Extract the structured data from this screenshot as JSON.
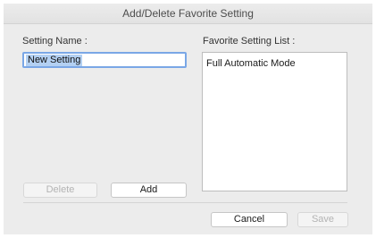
{
  "window": {
    "title": "Add/Delete Favorite Setting"
  },
  "setting_name": {
    "label": "Setting Name :",
    "value": "New Setting"
  },
  "favorite_list": {
    "label": "Favorite Setting List :",
    "items": [
      "Full Automatic Mode"
    ]
  },
  "buttons": {
    "delete": "Delete",
    "add": "Add",
    "cancel": "Cancel",
    "save": "Save"
  },
  "colors": {
    "focus_ring": "#7aa7e6",
    "selection": "#b3d0f2",
    "dialog_background": "#ececec"
  }
}
